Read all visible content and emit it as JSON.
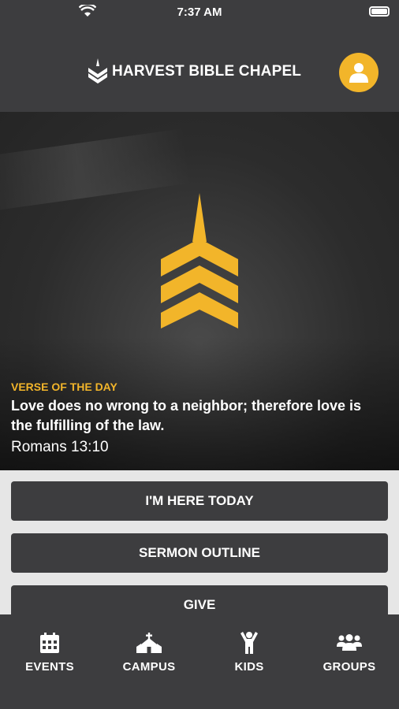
{
  "status": {
    "time": "7:37 AM"
  },
  "header": {
    "title": "HARVEST BIBLE CHAPEL"
  },
  "verse": {
    "eyebrow": "VERSE OF THE DAY",
    "text": "Love does no wrong to a neighbor; therefore love is the fulfilling of the law.",
    "reference": "Romans 13:10"
  },
  "actions": [
    {
      "label": "I'M HERE TODAY"
    },
    {
      "label": "SERMON OUTLINE"
    },
    {
      "label": "GIVE"
    }
  ],
  "tabs": [
    {
      "label": "EVENTS",
      "icon": "calendar-icon"
    },
    {
      "label": "CAMPUS",
      "icon": "church-icon"
    },
    {
      "label": "KIDS",
      "icon": "child-icon"
    },
    {
      "label": "GROUPS",
      "icon": "group-icon"
    }
  ],
  "colors": {
    "accent": "#f2b52a",
    "dark": "#3d3d3f",
    "light": "#e6e6e6"
  }
}
